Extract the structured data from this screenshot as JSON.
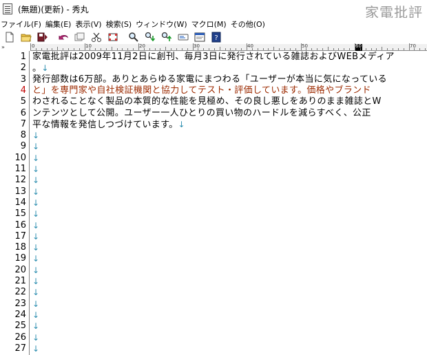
{
  "window": {
    "title": "(無題)(更新) - 秀丸",
    "watermark": "家電批評"
  },
  "menu": [
    "ファイル(F)",
    "編集(E)",
    "表示(V)",
    "検索(S)",
    "ウィンドウ(W)",
    "マクロ(M)",
    "その他(O)"
  ],
  "toolbar": {
    "icons": [
      "new-file-icon",
      "open-folder-icon",
      "save-icon",
      "undo-icon",
      "copy-icon",
      "cut-icon",
      "paste-icon",
      "search-icon",
      "search-down-icon",
      "search-up-icon",
      "grep-icon",
      "window-icon",
      "help-icon"
    ]
  },
  "ruler": {
    "corner": "»",
    "labels": [
      "0",
      "10",
      "20",
      "30",
      "40",
      "50",
      "60",
      "70"
    ],
    "cursor_column": "60"
  },
  "editor": {
    "current_line": 4,
    "newline_mark": "↓",
    "lines": [
      {
        "n": "1",
        "text": "家電批評は2009年11月2日に創刊、毎月3日に発行されている雑誌およびWEBメディア"
      },
      {
        "n": "2",
        "text": "。"
      },
      {
        "n": "3",
        "text": "発行部数は6万部。ありとあらゆる家電にまつわる「ユーザーが本当に気になっている"
      },
      {
        "n": "4",
        "text": "と」を専門家や自社検証機関と協力してテスト・評価しています。価格やブランド"
      },
      {
        "n": "5",
        "text": "わされることなく製品の本質的な性能を見極め、その良し悪しをありのまま雑誌とW"
      },
      {
        "n": "6",
        "text": "ンテンツとして公開。ユーザー一人ひとりの買い物のハードルを減らすべく、公正"
      },
      {
        "n": "7",
        "text": "平な情報を発信しつづけています。"
      },
      {
        "n": "8",
        "text": ""
      },
      {
        "n": "9",
        "text": ""
      },
      {
        "n": "10",
        "text": ""
      },
      {
        "n": "11",
        "text": ""
      },
      {
        "n": "12",
        "text": ""
      },
      {
        "n": "13",
        "text": ""
      },
      {
        "n": "14",
        "text": ""
      },
      {
        "n": "15",
        "text": ""
      },
      {
        "n": "16",
        "text": ""
      },
      {
        "n": "17",
        "text": ""
      },
      {
        "n": "18",
        "text": ""
      },
      {
        "n": "19",
        "text": ""
      },
      {
        "n": "20",
        "text": ""
      },
      {
        "n": "21",
        "text": ""
      },
      {
        "n": "22",
        "text": ""
      },
      {
        "n": "23",
        "text": ""
      },
      {
        "n": "24",
        "text": ""
      },
      {
        "n": "25",
        "text": ""
      },
      {
        "n": "26",
        "text": ""
      },
      {
        "n": "27",
        "text": ""
      }
    ]
  }
}
